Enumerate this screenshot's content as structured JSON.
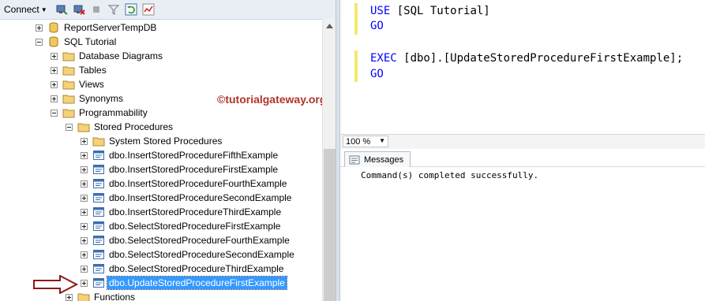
{
  "toolbar": {
    "connect_label": "Connect"
  },
  "tree": {
    "items": [
      {
        "label": "ReportServerTempDB",
        "icon": "database-icon"
      },
      {
        "label": "SQL Tutorial",
        "icon": "database-icon"
      },
      {
        "label": "Database Diagrams",
        "icon": "folder-icon"
      },
      {
        "label": "Tables",
        "icon": "folder-icon"
      },
      {
        "label": "Views",
        "icon": "folder-icon"
      },
      {
        "label": "Synonyms",
        "icon": "folder-icon"
      },
      {
        "label": "Programmability",
        "icon": "folder-icon"
      },
      {
        "label": "Stored Procedures",
        "icon": "folder-icon"
      },
      {
        "label": "System Stored Procedures",
        "icon": "folder-icon"
      },
      {
        "label": "dbo.InsertStoredProcedureFifthExample",
        "icon": "stored-procedure-icon"
      },
      {
        "label": "dbo.InsertStoredProcedureFirstExample",
        "icon": "stored-procedure-icon"
      },
      {
        "label": "dbo.InsertStoredProcedureFourthExample",
        "icon": "stored-procedure-icon"
      },
      {
        "label": "dbo.InsertStoredProcedureSecondExample",
        "icon": "stored-procedure-icon"
      },
      {
        "label": "dbo.InsertStoredProcedureThirdExample",
        "icon": "stored-procedure-icon"
      },
      {
        "label": "dbo.SelectStoredProcedureFirstExample",
        "icon": "stored-procedure-icon"
      },
      {
        "label": "dbo.SelectStoredProcedureFourthExample",
        "icon": "stored-procedure-icon"
      },
      {
        "label": "dbo.SelectStoredProcedureSecondExample",
        "icon": "stored-procedure-icon"
      },
      {
        "label": "dbo.SelectStoredProcedureThirdExample",
        "icon": "stored-procedure-icon"
      },
      {
        "label": "dbo.UpdateStoredProcedureFirstExample",
        "icon": "stored-procedure-icon",
        "selected": true
      },
      {
        "label": "Functions",
        "icon": "folder-icon"
      }
    ]
  },
  "watermark": "©tutorialgateway.org",
  "editor": {
    "lines": {
      "l1_kw": "USE",
      "l1_rest": " [SQL Tutorial]",
      "l2_kw": "GO",
      "l4_kw": "EXEC",
      "l4_rest": " [dbo].[UpdateStoredProcedureFirstExample];",
      "l5_kw": "GO"
    }
  },
  "zoom": {
    "value": "100 %"
  },
  "results": {
    "tab_label": "Messages",
    "message": "Command(s) completed successfully."
  },
  "colors": {
    "keyword": "#0000ff",
    "selection": "#3399ff",
    "watermark": "#b0342a",
    "change_marker": "#f5e86a",
    "arrow": "#8b1a1a"
  }
}
